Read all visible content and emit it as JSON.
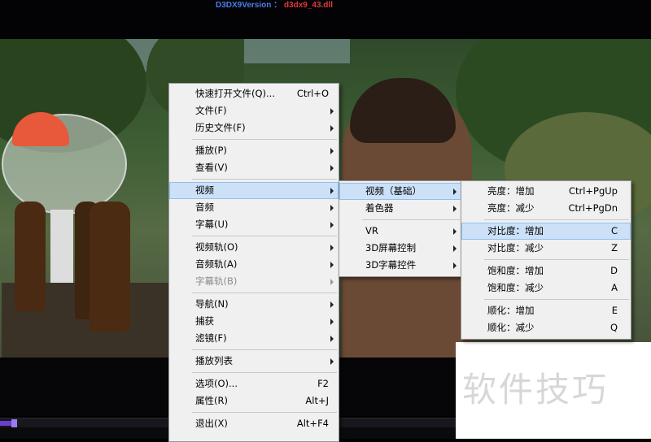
{
  "top_info": {
    "key": "D3DX9Version ：",
    "value": "d3dx9_43.dll"
  },
  "menu_main": {
    "items": [
      {
        "label": "快速打开文件(Q)...",
        "shortcut": "Ctrl+O"
      },
      {
        "label": "文件(F)",
        "submenu": true
      },
      {
        "label": "历史文件(F)",
        "submenu": true
      },
      {
        "label": "播放(P)",
        "submenu": true
      },
      {
        "label": "查看(V)",
        "submenu": true
      },
      {
        "label": "视频",
        "submenu": true,
        "active": true
      },
      {
        "label": "音频",
        "submenu": true
      },
      {
        "label": "字幕(U)",
        "submenu": true
      },
      {
        "label": "视频轨(O)",
        "submenu": true
      },
      {
        "label": "音频轨(A)",
        "submenu": true
      },
      {
        "label": "字幕轨(B)",
        "submenu": true,
        "disabled": true
      },
      {
        "label": "导航(N)",
        "submenu": true
      },
      {
        "label": "捕获",
        "submenu": true
      },
      {
        "label": "滤镜(F)",
        "submenu": true
      },
      {
        "label": "播放列表",
        "submenu": true
      },
      {
        "label": "选项(O)...",
        "shortcut": "F2"
      },
      {
        "label": "属性(R)",
        "shortcut": "Alt+J"
      },
      {
        "label": "退出(X)",
        "shortcut": "Alt+F4"
      }
    ]
  },
  "menu_video": {
    "items": [
      {
        "label": "视频（基础）",
        "submenu": true,
        "active": true
      },
      {
        "label": "着色器",
        "submenu": true
      },
      {
        "label": "VR",
        "submenu": true
      },
      {
        "label": "3D屏幕控制",
        "submenu": true
      },
      {
        "label": "3D字幕控件",
        "submenu": true
      }
    ]
  },
  "menu_basic": {
    "items": [
      {
        "label": "亮度：增加",
        "shortcut": "Ctrl+PgUp"
      },
      {
        "label": "亮度：减少",
        "shortcut": "Ctrl+PgDn"
      },
      {
        "label": "对比度：增加",
        "shortcut": "C",
        "active": true
      },
      {
        "label": "对比度：减少",
        "shortcut": "Z"
      },
      {
        "label": "饱和度：增加",
        "shortcut": "D"
      },
      {
        "label": "饱和度：减少",
        "shortcut": "A"
      },
      {
        "label": "顺化：增加",
        "shortcut": "E"
      },
      {
        "label": "顺化：减少",
        "shortcut": "Q"
      }
    ]
  },
  "watermark": "软件技巧"
}
